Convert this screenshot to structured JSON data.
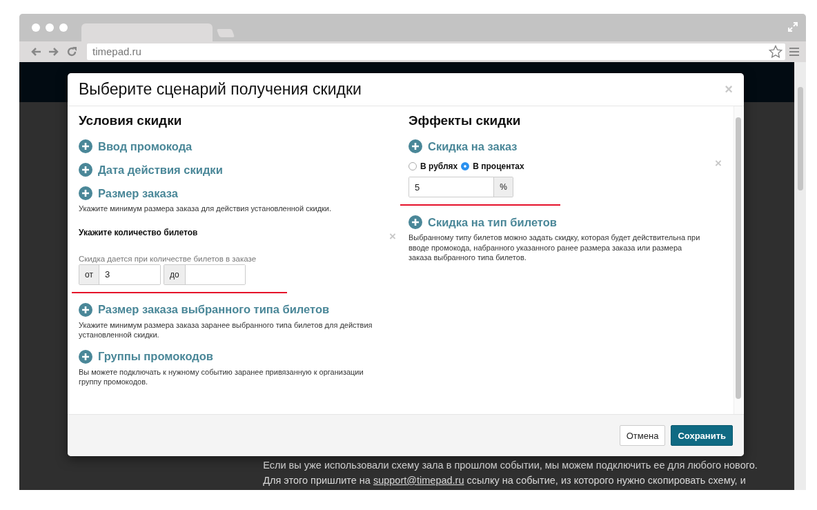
{
  "browser": {
    "url": "timepad.ru"
  },
  "page": {
    "lines": [
      {
        "text": "Если вы уже использовали схему зала в прошлом событии, мы можем подключить ее для любого нового."
      },
      {
        "text": "Для этого пришлите на ",
        "link": "support@timepad.ru",
        "after": " ссылку на событие, из которого нужно скопировать схему, и"
      }
    ]
  },
  "modal": {
    "title": "Выберите сценарий получения скидки",
    "close": "×",
    "conditions": {
      "heading": "Условия скидки",
      "items": [
        {
          "label": "Ввод промокода"
        },
        {
          "label": "Дата действия скидки"
        },
        {
          "label": "Размер заказа",
          "description": "Укажите минимум размера заказа для действия установленной скидки.",
          "detail": {
            "kind": "range",
            "title": "Укажите количество билетов",
            "remove": "×",
            "hint": "Скидка дается при количестве билетов в заказе",
            "from_label": "от",
            "from_value": "3",
            "to_label": "до"
          }
        },
        {
          "label": "Размер заказа выбранного типа билетов",
          "description": "Укажите минимум размера заказа заранее выбранного типа билетов для действия установленной скидки."
        },
        {
          "label": "Группы промокодов",
          "description": "Вы можете подключать к нужному событию заранее привязанную к организации группу промокодов."
        }
      ]
    },
    "effects": {
      "heading": "Эффекты скидки",
      "items": [
        {
          "label": "Скидка на заказ",
          "detail": {
            "kind": "amount",
            "remove": "×",
            "options": [
              {
                "label": "В рублях",
                "selected": false
              },
              {
                "label": "В процентах",
                "selected": true
              }
            ],
            "value": "5",
            "unit": "%"
          }
        },
        {
          "label": "Скидка на тип билетов",
          "description": "Выбранному типу билетов можно задать скидку, которая будет действительна при вводе промокода, набранного указанного ранее размера заказа или размера заказа выбранного типа билетов."
        }
      ]
    },
    "buttons": [
      {
        "label": "Отмена",
        "kind": "secondary"
      },
      {
        "label": "Сохранить",
        "kind": "primary"
      }
    ]
  }
}
